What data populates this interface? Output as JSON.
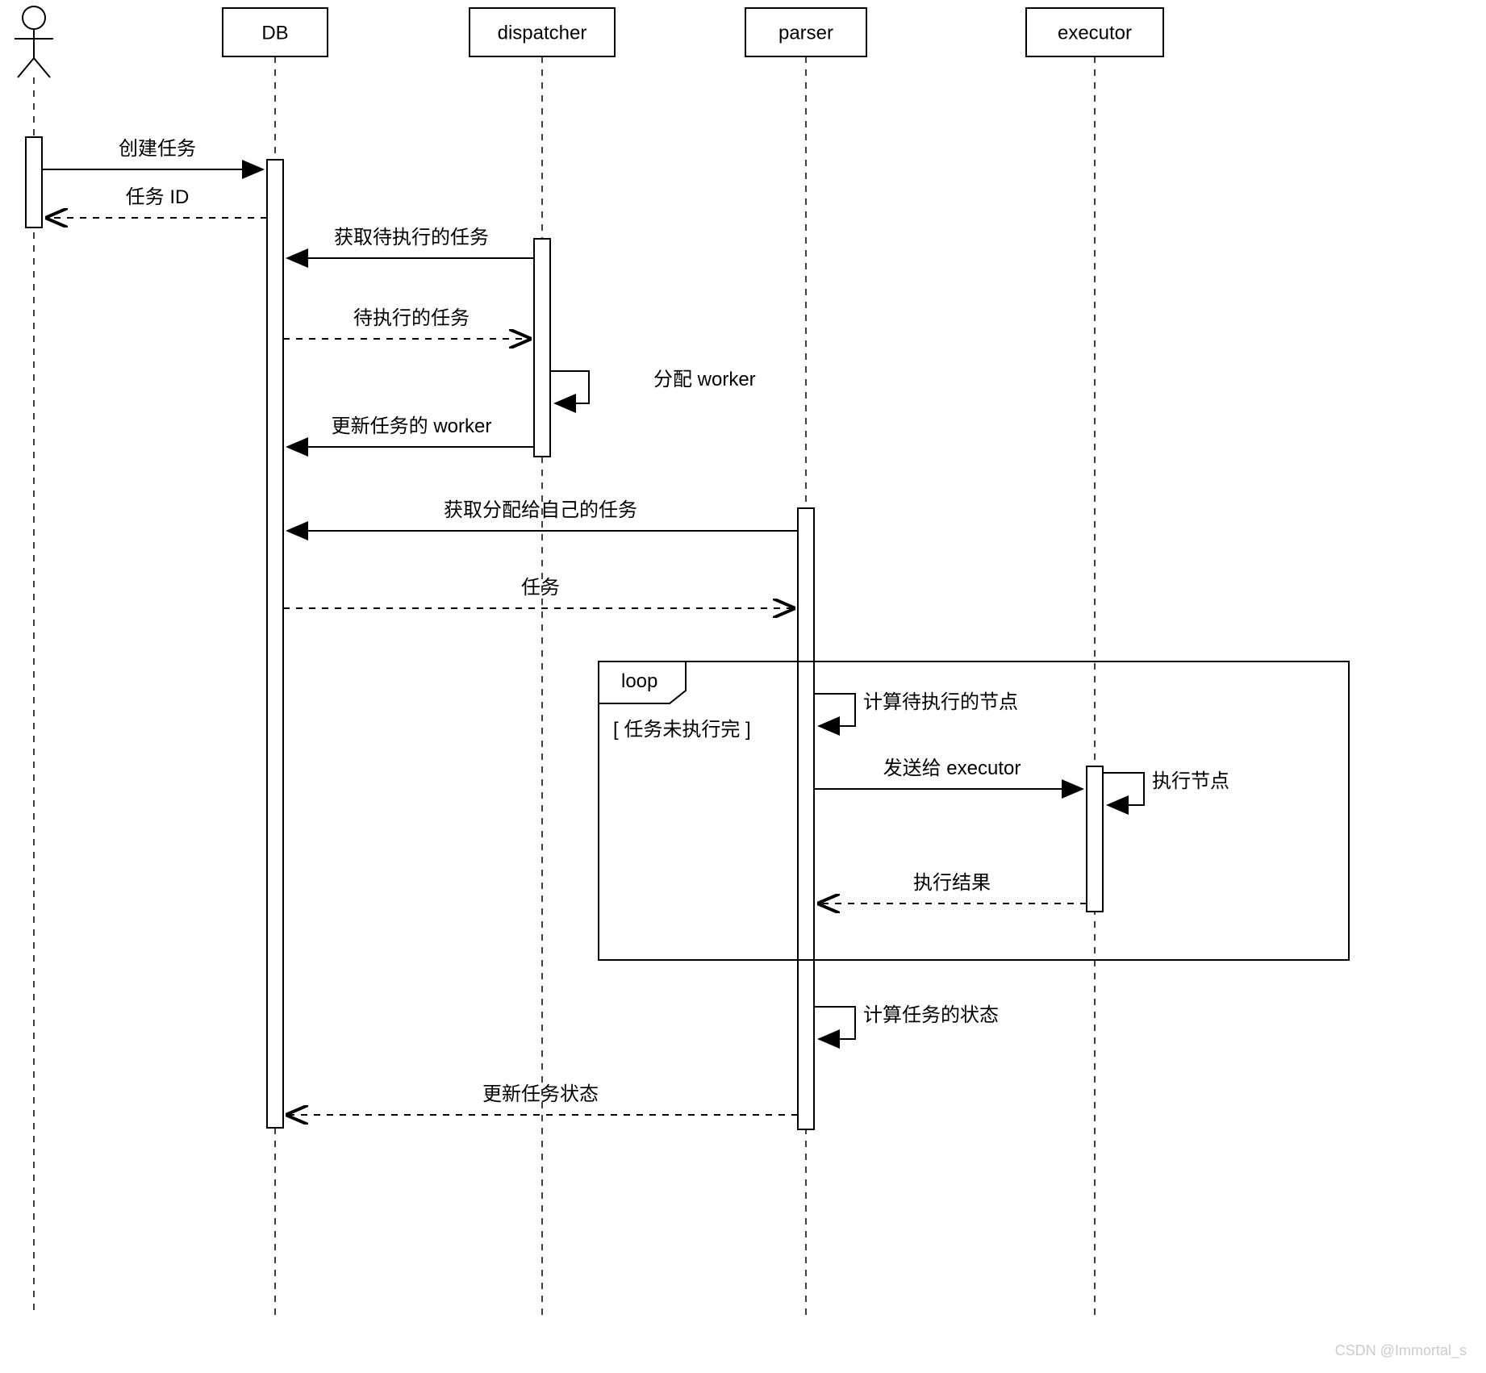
{
  "participants": {
    "db": "DB",
    "dispatcher": "dispatcher",
    "parser": "parser",
    "executor": "executor"
  },
  "messages": {
    "create_task": "创建任务",
    "task_id": "任务 ID",
    "get_pending": "获取待执行的任务",
    "pending_tasks": "待执行的任务",
    "assign_worker": "分配 worker",
    "update_worker": "更新任务的 worker",
    "get_assigned": "获取分配给自己的任务",
    "task": "任务",
    "compute_nodes": "计算待执行的节点",
    "send_executor": "发送给 executor",
    "execute_node": "执行节点",
    "exec_result": "执行结果",
    "compute_status": "计算任务的状态",
    "update_status": "更新任务状态"
  },
  "loop": {
    "label": "loop",
    "condition": "[ 任务未执行完 ]"
  },
  "watermark": "CSDN @Immortal_s"
}
